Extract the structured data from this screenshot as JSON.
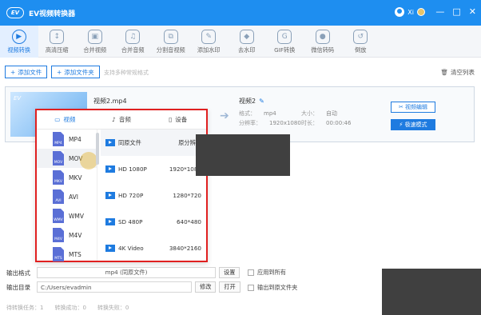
{
  "app": {
    "logo_text": "EV",
    "title": "EV视频转换器",
    "username": "Xi",
    "window_controls": [
      "—",
      "□",
      "✕"
    ]
  },
  "toolbar": [
    {
      "label": "视频转换",
      "icon": "convert-icon",
      "active": true
    },
    {
      "label": "高清压缩",
      "icon": "compress-icon"
    },
    {
      "label": "合并视频",
      "icon": "merge-video-icon"
    },
    {
      "label": "合并音频",
      "icon": "merge-audio-icon"
    },
    {
      "label": "分割音视频",
      "icon": "split-icon"
    },
    {
      "label": "添加水印",
      "icon": "add-watermark-icon"
    },
    {
      "label": "去水印",
      "icon": "remove-watermark-icon"
    },
    {
      "label": "GIF转换",
      "icon": "gif-icon"
    },
    {
      "label": "微信转码",
      "icon": "wechat-icon"
    },
    {
      "label": "倒放",
      "icon": "reverse-icon"
    }
  ],
  "actions": {
    "add_file": "添加文件",
    "add_folder": "添加文件夹",
    "hint": "支持多种常规格式",
    "clear": "清空列表"
  },
  "file": {
    "source_name": "视频2.mp4",
    "output_name": "视频2",
    "format_label": "格式：",
    "format_value": "mp4",
    "size_label": "大小：",
    "size_value": "自动",
    "res_label": "分辨率：",
    "res_value": "1920x1080",
    "dur_label": "时长：",
    "dur_value": "00:00:46",
    "edit_button": "视频编辑",
    "speed_button": "极速模式"
  },
  "popup": {
    "tabs": [
      {
        "label": "视频",
        "active": true
      },
      {
        "label": "音频"
      },
      {
        "label": "设备"
      }
    ],
    "formats": [
      {
        "label": "MP4"
      },
      {
        "label": "MOV",
        "selected": true
      },
      {
        "label": "MKV"
      },
      {
        "label": "AVI"
      },
      {
        "label": "WMV"
      },
      {
        "label": "M4V"
      },
      {
        "label": "MTS"
      }
    ],
    "resolutions": [
      {
        "name": "同原文件",
        "size": "原分辨率",
        "selected": true
      },
      {
        "name": "HD 1080P",
        "size": "1920*1080"
      },
      {
        "name": "HD 720P",
        "size": "1280*720"
      },
      {
        "name": "SD 480P",
        "size": "640*480"
      },
      {
        "name": "4K Video",
        "size": "3840*2160"
      }
    ]
  },
  "bottom": {
    "out_format_label": "输出格式",
    "out_format_value": "mp4 (同原文件)",
    "settings_button": "设置",
    "apply_all": "应用到所有",
    "out_dir_label": "输出目录",
    "out_dir_value": "C:/Users/evadmin",
    "modify_button": "修改",
    "open_button": "打开",
    "to_source": "输出到原文件夹",
    "status_pending": "待转换任务：1",
    "status_success": "转换成功：0",
    "status_failed": "转换失败：0"
  }
}
